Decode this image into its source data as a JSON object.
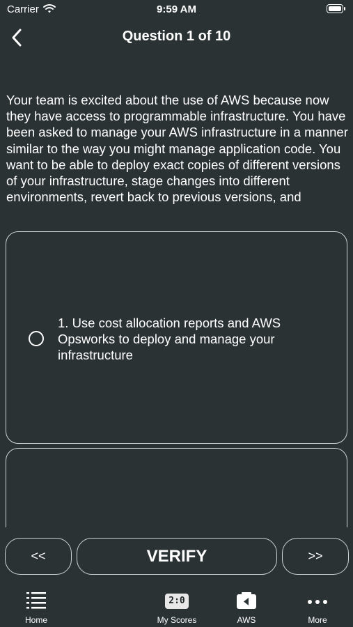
{
  "status_bar": {
    "carrier": "Carrier",
    "time": "9:59 AM",
    "icons": [
      "wifi-icon",
      "battery-icon"
    ]
  },
  "nav": {
    "title": "Question 1 of 10",
    "back_icon": "chevron-left-icon"
  },
  "question": {
    "text": "Your team is excited about the use of AWS because now they have access to programmable infrastructure. You have been asked to manage your AWS infrastructure in a manner similar to the way you might manage application code. You want to be able to deploy exact copies of different versions of your infrastructure, stage changes into different environments, revert back to previous versions, and"
  },
  "options": [
    {
      "label": "1. Use cost allocation reports and AWS Opsworks to deploy and manage your infrastructure",
      "selected": false
    }
  ],
  "controls": {
    "prev_label": "<<",
    "verify_label": "VERIFY",
    "next_label": ">>"
  },
  "tab_bar": {
    "items": [
      {
        "label": "Home",
        "icon": "list-icon"
      },
      {
        "label": "My Scores",
        "icon": "scoreboard-icon",
        "badge": "2:0"
      },
      {
        "label": "AWS",
        "icon": "folder-back-icon"
      },
      {
        "label": "More",
        "icon": "more-dots-icon"
      }
    ]
  },
  "colors": {
    "background": "#2b3233",
    "border": "#cfd4d4",
    "text": "#ffffff"
  }
}
